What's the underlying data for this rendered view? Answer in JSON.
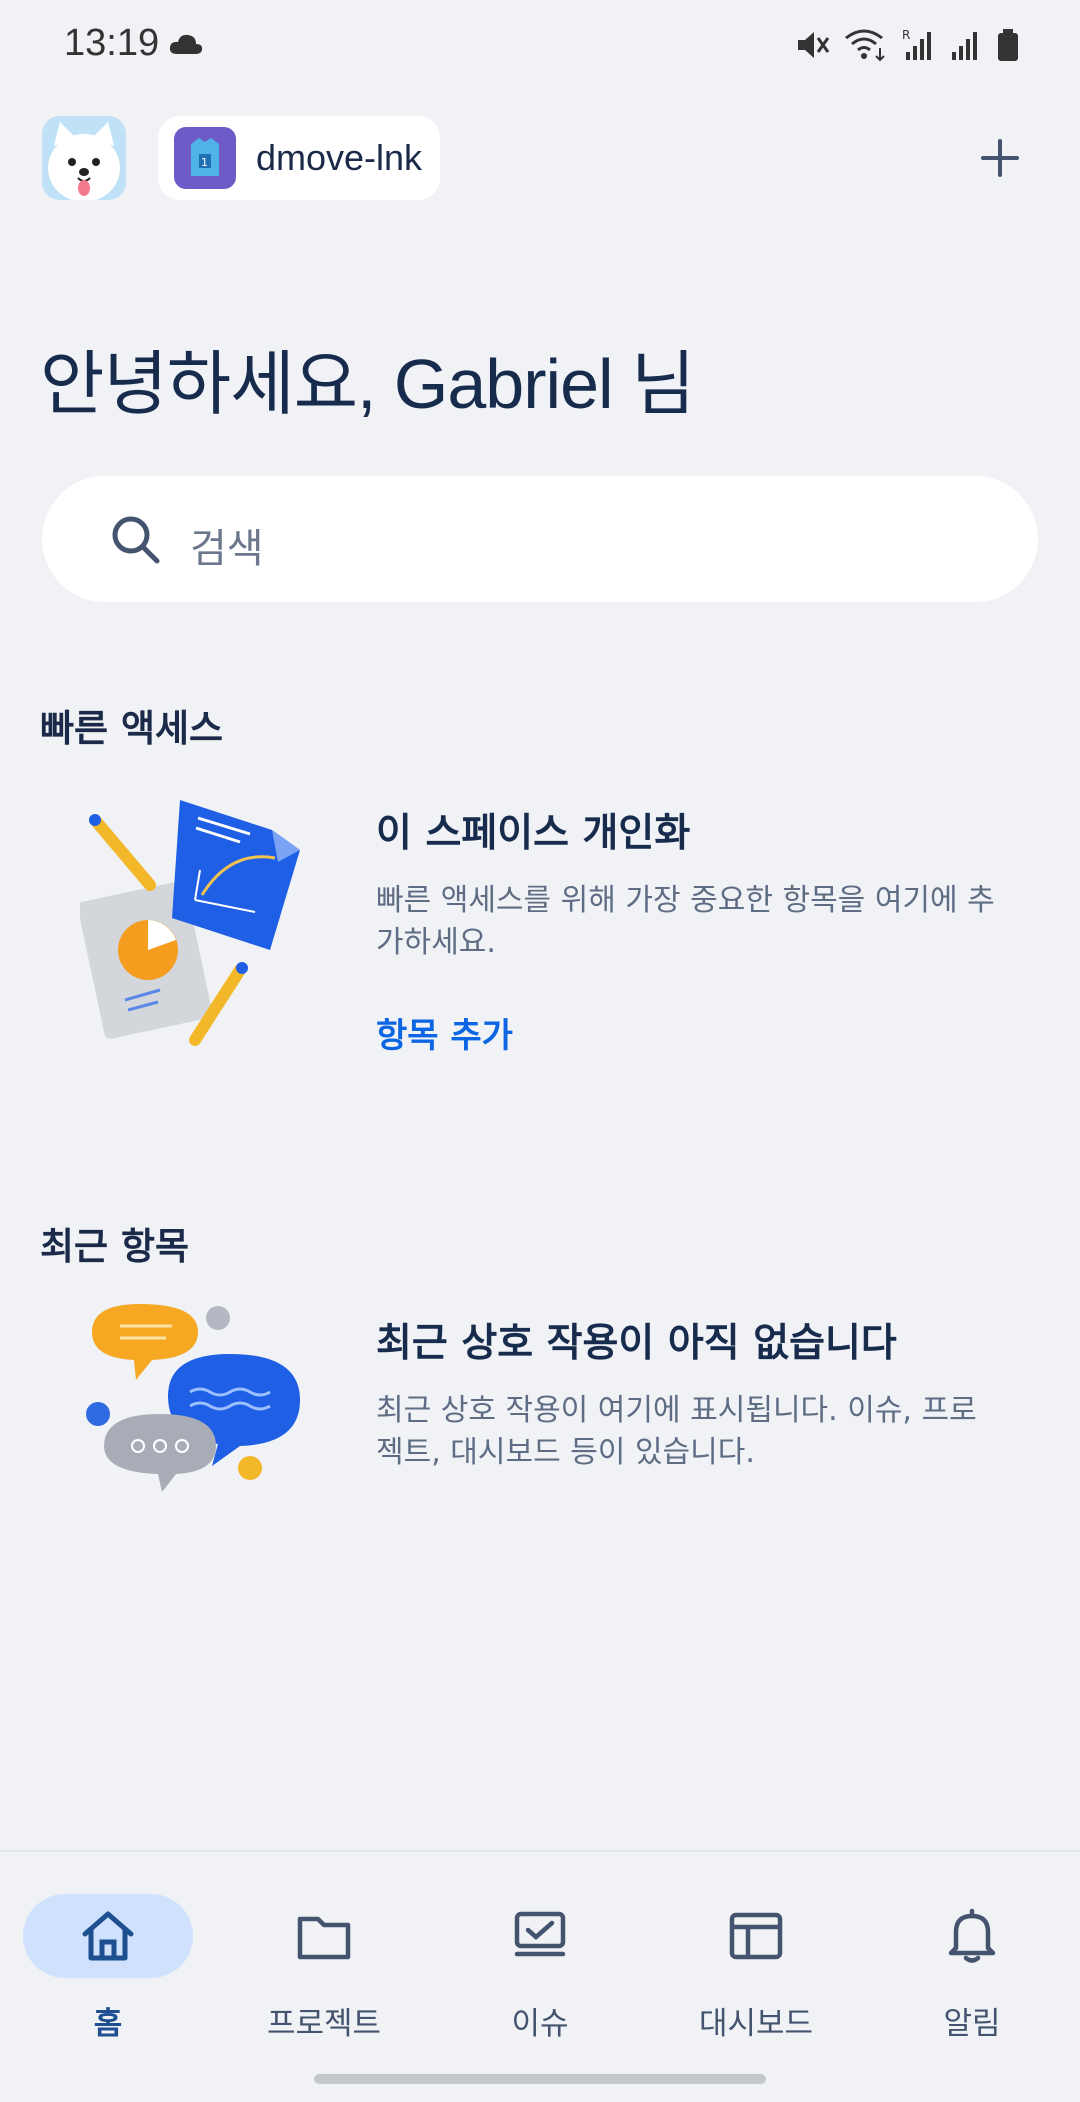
{
  "status": {
    "time": "13:19"
  },
  "header": {
    "workspace_name": "dmove-lnk",
    "add_label": "+"
  },
  "greeting": "안녕하세요, Gabriel 님",
  "search": {
    "placeholder": "검색"
  },
  "quick_access": {
    "title": "빠른 액세스",
    "card_title": "이 스페이스 개인화",
    "card_desc": "빠른 액세스를 위해 가장 중요한 항목을 여기에 추가하세요.",
    "link": "항목 추가"
  },
  "recent": {
    "title": "최근 항목",
    "card_title": "최근 상호 작용이 아직 없습니다",
    "card_desc": "최근 상호 작용이 여기에 표시됩니다. 이슈, 프로젝트, 대시보드 등이 있습니다."
  },
  "nav": [
    {
      "label": "홈",
      "icon": "home-icon",
      "active": true
    },
    {
      "label": "프로젝트",
      "icon": "folder-icon",
      "active": false
    },
    {
      "label": "이슈",
      "icon": "issue-icon",
      "active": false
    },
    {
      "label": "대시보드",
      "icon": "dashboard-icon",
      "active": false
    },
    {
      "label": "알림",
      "icon": "bell-icon",
      "active": false
    }
  ],
  "colors": {
    "accent": "#0c66e4",
    "background": "#f0f2f5",
    "nav_active_bg": "#cfe1fd"
  }
}
